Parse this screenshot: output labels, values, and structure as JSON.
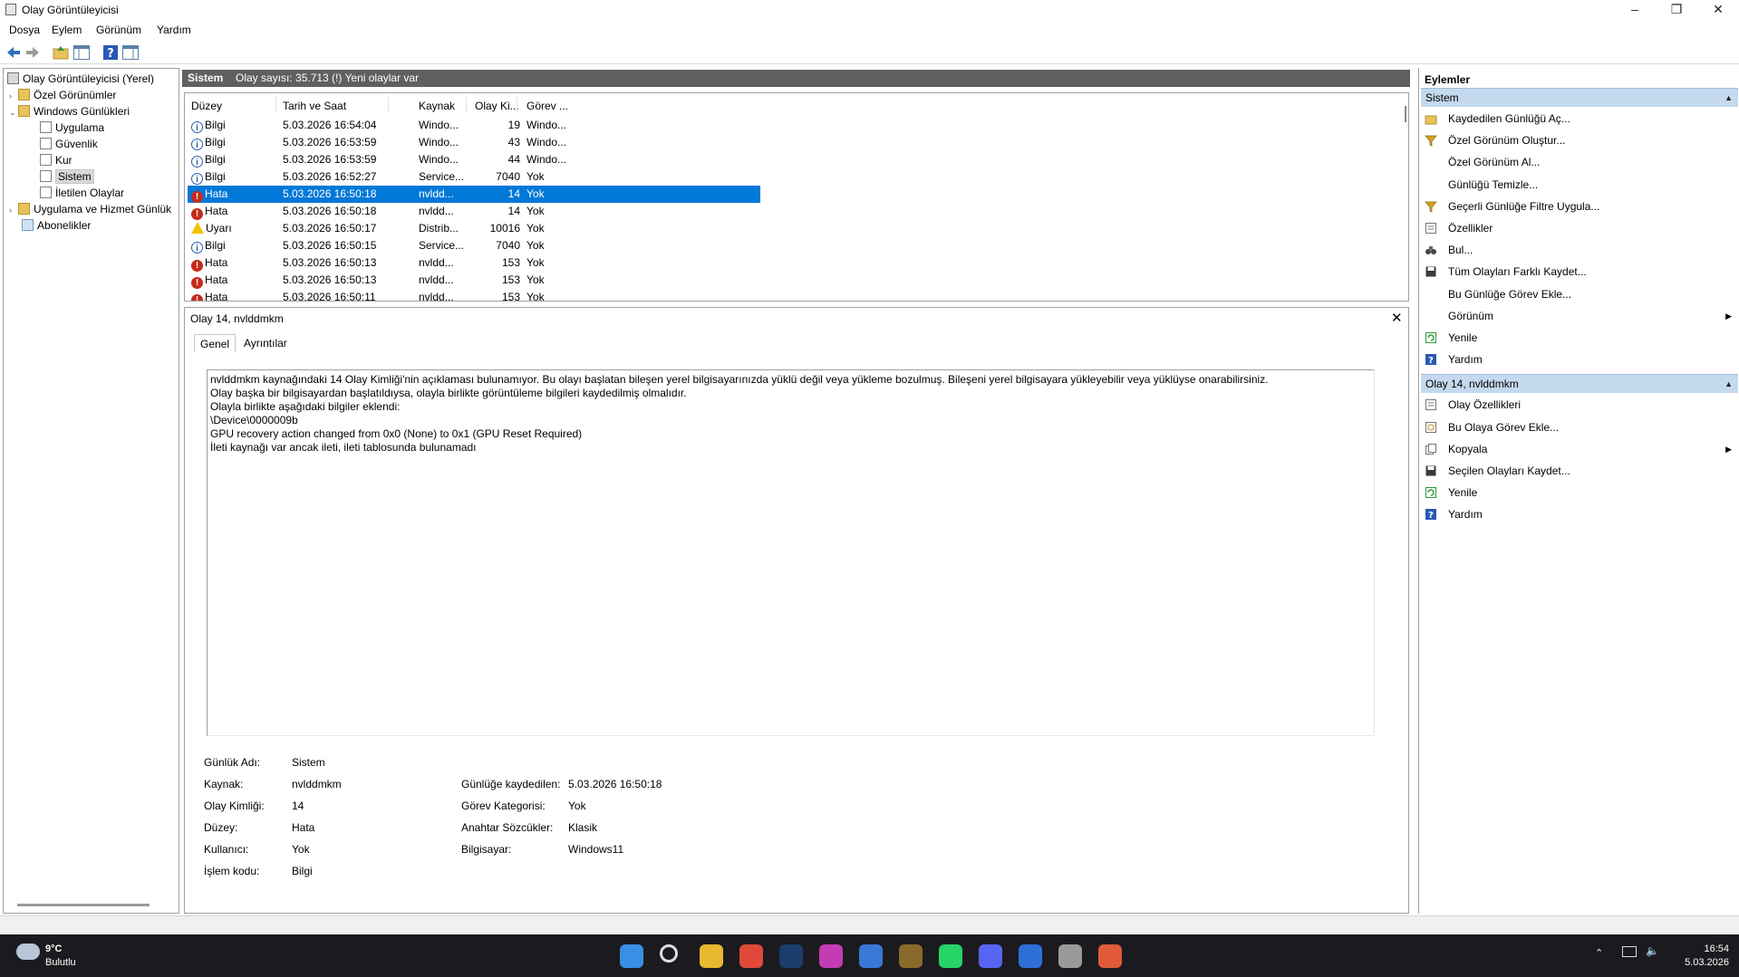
{
  "window": {
    "title": "Olay Görüntüleyicisi"
  },
  "menu": [
    "Dosya",
    "Eylem",
    "Görünüm",
    "Yardım"
  ],
  "tree": [
    {
      "label": "Olay Görüntüleyicisi (Yerel)",
      "icon": "event-viewer-icon",
      "level": 0
    },
    {
      "label": "Özel Görünümler",
      "icon": "folder-icon",
      "level": 1,
      "expander": "›"
    },
    {
      "label": "Windows Günlükleri",
      "icon": "folder-icon",
      "level": 1,
      "expander": "⌄"
    },
    {
      "label": "Uygulama",
      "icon": "log-icon",
      "level": 2
    },
    {
      "label": "Güvenlik",
      "icon": "log-icon",
      "level": 2
    },
    {
      "label": "Kur",
      "icon": "log-icon",
      "level": 2
    },
    {
      "label": "Sistem",
      "icon": "log-icon",
      "level": 2,
      "selected": true
    },
    {
      "label": "İletilen Olaylar",
      "icon": "log-icon",
      "level": 2
    },
    {
      "label": "Uygulama ve Hizmet Günlük",
      "icon": "folder-icon",
      "level": 1,
      "expander": "›"
    },
    {
      "label": "Abonelikler",
      "icon": "subscriptions-icon",
      "level": 1
    }
  ],
  "log_header": {
    "name": "Sistem",
    "count": "Olay sayısı: 35.713 (!) Yeni olaylar var"
  },
  "columns": [
    "Düzey",
    "Tarih ve Saat",
    "Kaynak",
    "Olay Ki...",
    "Görev ..."
  ],
  "events": [
    {
      "level": "Bilgi",
      "kind": "info",
      "date": "5.03.2026 16:54:04",
      "source": "Windo...",
      "id": "19",
      "task": "Windo..."
    },
    {
      "level": "Bilgi",
      "kind": "info",
      "date": "5.03.2026 16:53:59",
      "source": "Windo...",
      "id": "43",
      "task": "Windo..."
    },
    {
      "level": "Bilgi",
      "kind": "info",
      "date": "5.03.2026 16:53:59",
      "source": "Windo...",
      "id": "44",
      "task": "Windo..."
    },
    {
      "level": "Bilgi",
      "kind": "info",
      "date": "5.03.2026 16:52:27",
      "source": "Service...",
      "id": "7040",
      "task": "Yok"
    },
    {
      "level": "Hata",
      "kind": "error",
      "date": "5.03.2026 16:50:18",
      "source": "nvldd...",
      "id": "14",
      "task": "Yok",
      "selected": true
    },
    {
      "level": "Hata",
      "kind": "error",
      "date": "5.03.2026 16:50:18",
      "source": "nvldd...",
      "id": "14",
      "task": "Yok"
    },
    {
      "level": "Uyarı",
      "kind": "warning",
      "date": "5.03.2026 16:50:17",
      "source": "Distrib...",
      "id": "10016",
      "task": "Yok"
    },
    {
      "level": "Bilgi",
      "kind": "info",
      "date": "5.03.2026 16:50:15",
      "source": "Service...",
      "id": "7040",
      "task": "Yok"
    },
    {
      "level": "Hata",
      "kind": "error",
      "date": "5.03.2026 16:50:13",
      "source": "nvldd...",
      "id": "153",
      "task": "Yok"
    },
    {
      "level": "Hata",
      "kind": "error",
      "date": "5.03.2026 16:50:13",
      "source": "nvldd...",
      "id": "153",
      "task": "Yok"
    },
    {
      "level": "Hata",
      "kind": "error",
      "date": "5.03.2026 16:50:11",
      "source": "nvldd...",
      "id": "153",
      "task": "Yok"
    }
  ],
  "detail": {
    "header": "Olay 14, nvlddmkm",
    "tabs": [
      "Genel",
      "Ayrıntılar"
    ],
    "description": [
      "nvlddmkm kaynağındaki 14 Olay Kimliği'nin açıklaması bulunamıyor. Bu olayı başlatan bileşen yerel bilgisayarınızda yüklü değil veya yükleme bozulmuş. Bileşeni yerel bilgisayara yükleyebilir veya yüklüyse onarabilirsiniz.",
      "",
      "Olay başka bir bilgisayardan başlatıldıysa, olayla birlikte görüntüleme bilgileri kaydedilmiş olmalıdır.",
      "",
      "Olayla birlikte aşağıdaki bilgiler eklendi:",
      "",
      "\\Device\\0000009b",
      "GPU recovery action changed from 0x0 (None) to 0x1 (GPU Reset Required)",
      "",
      "İleti kaynağı var ancak ileti, ileti tablosunda bulunamadı"
    ],
    "fields_left": [
      {
        "label": "Günlük Adı:",
        "value": "Sistem"
      },
      {
        "label": "Kaynak:",
        "value": "nvlddmkm"
      },
      {
        "label": "Olay Kimliği:",
        "value": "14"
      },
      {
        "label": "Düzey:",
        "value": "Hata"
      },
      {
        "label": "Kullanıcı:",
        "value": "Yok"
      },
      {
        "label": "İşlem kodu:",
        "value": "Bilgi"
      }
    ],
    "fields_right": [
      {
        "label": "Günlüğe kaydedilen:",
        "value": "5.03.2026 16:50:18"
      },
      {
        "label": "Görev Kategorisi:",
        "value": "Yok"
      },
      {
        "label": "Anahtar Sözcükler:",
        "value": "Klasik"
      },
      {
        "label": "Bilgisayar:",
        "value": "Windows11"
      }
    ]
  },
  "actions": {
    "title": "Eylemler",
    "sections": [
      {
        "header": "Sistem",
        "items": [
          {
            "label": "Kaydedilen Günlüğü Aç...",
            "icon": "open-folder-icon"
          },
          {
            "label": "Özel Görünüm Oluştur...",
            "icon": "filter-icon"
          },
          {
            "label": "Özel Görünüm Al...",
            "icon": ""
          },
          {
            "label": "Günlüğü Temizle...",
            "icon": ""
          },
          {
            "label": "Geçerli Günlüğe Filtre Uygula...",
            "icon": "filter-icon"
          },
          {
            "label": "Özellikler",
            "icon": "properties-icon"
          },
          {
            "label": "Bul...",
            "icon": "binoculars-icon"
          },
          {
            "label": "Tüm Olayları Farklı Kaydet...",
            "icon": "save-icon"
          },
          {
            "label": "Bu Günlüğe Görev Ekle...",
            "icon": ""
          },
          {
            "label": "Görünüm",
            "icon": "",
            "submenu": true
          },
          {
            "label": "Yenile",
            "icon": "refresh-icon"
          },
          {
            "label": "Yardım",
            "icon": "help-icon"
          }
        ]
      },
      {
        "header": "Olay 14, nvlddmkm",
        "items": [
          {
            "label": "Olay Özellikleri",
            "icon": "properties-icon"
          },
          {
            "label": "Bu Olaya Görev Ekle...",
            "icon": "task-icon"
          },
          {
            "label": "Kopyala",
            "icon": "copy-icon",
            "submenu": true
          },
          {
            "label": "Seçilen Olayları Kaydet...",
            "icon": "save-icon"
          },
          {
            "label": "Yenile",
            "icon": "refresh-icon"
          },
          {
            "label": "Yardım",
            "icon": "help-icon"
          }
        ]
      }
    ]
  },
  "taskbar": {
    "temperature": "9°C",
    "condition": "Bulutlu",
    "time": "16:54",
    "date": "5.03.2026",
    "apps": [
      "start-icon",
      "search-icon",
      "file-explorer-icon",
      "chrome-icon",
      "steam-icon",
      "app-icon",
      "app-icon",
      "league-icon",
      "whatsapp-icon",
      "discord-icon",
      "outlook-icon",
      "event-viewer-icon",
      "app-icon"
    ]
  },
  "colors": {
    "selection": "#0078d7",
    "section_header": "#c4d9ee",
    "log_header": "#606060",
    "error": "#c42b1c",
    "warning": "#f2c200",
    "info": "#2a5caa"
  }
}
